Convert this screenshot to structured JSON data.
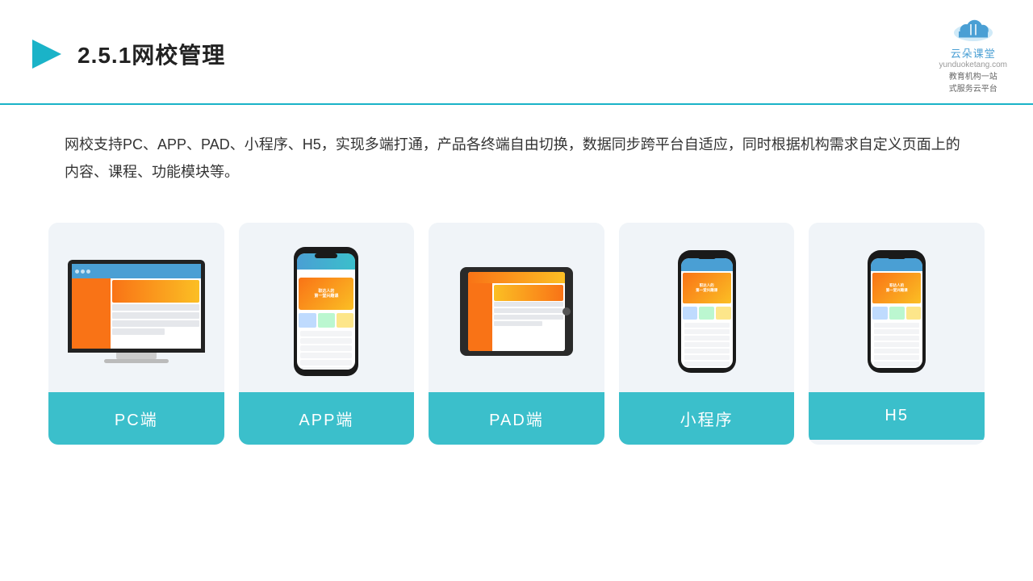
{
  "header": {
    "title": "2.5.1网校管理",
    "brand_name": "云朵课堂",
    "brand_url": "yunduoketang.com",
    "brand_tagline": "教育机构一站\n式服务云平台"
  },
  "description": {
    "text": "网校支持PC、APP、PAD、小程序、H5，实现多端打通，产品各终端自由切换，数据同步跨平台自适应，同时根据机构需求自定义页面上的内容、课程、功能模块等。"
  },
  "cards": [
    {
      "label": "PC端"
    },
    {
      "label": "APP端"
    },
    {
      "label": "PAD端"
    },
    {
      "label": "小程序"
    },
    {
      "label": "H5"
    }
  ]
}
